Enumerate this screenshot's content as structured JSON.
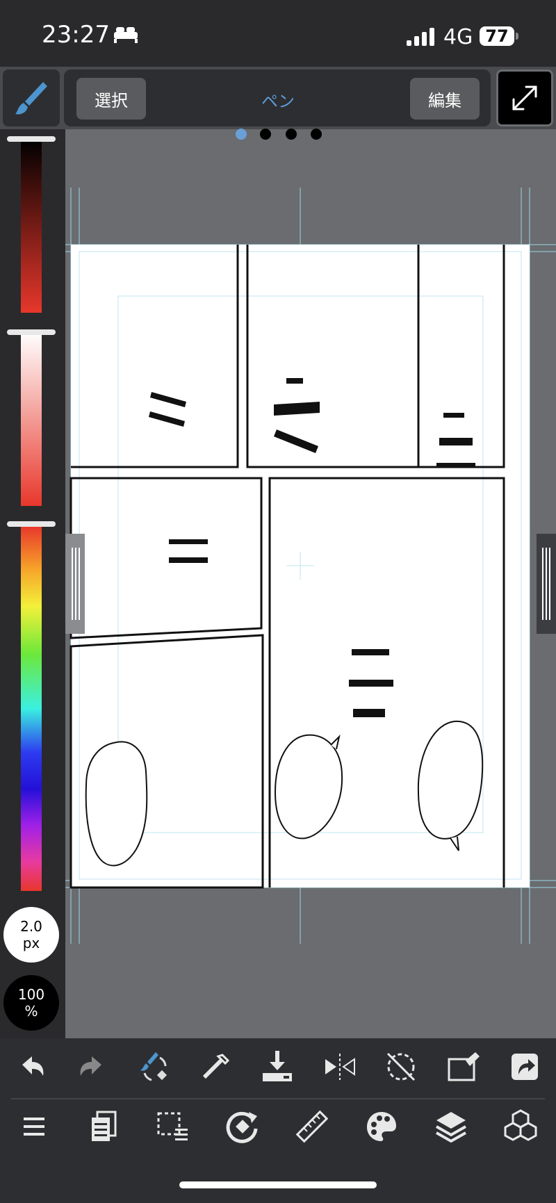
{
  "status_bar": {
    "time": "23:27",
    "network": "4G",
    "battery": "77",
    "icons": [
      "bed-icon",
      "signal-icon",
      "battery-icon"
    ]
  },
  "top_toolbar": {
    "select_label": "選択",
    "title": "ペン",
    "edit_label": "編集",
    "icons": [
      "brush-icon",
      "fullscreen-icon"
    ]
  },
  "pager": {
    "count": 4,
    "active_index": 0
  },
  "left_panel": {
    "brush_size_value": "2.0",
    "brush_size_unit": "px",
    "opacity_value": "100",
    "opacity_unit": "%"
  },
  "colors": {
    "accent": "#5b9bd6",
    "panel_bg": "#2a2a2c",
    "canvas_bg": "#6a6c70",
    "paper": "#ffffff",
    "guide": "#9fd6e6"
  },
  "bottom_toolbar": {
    "row1": [
      "undo-icon",
      "redo-icon",
      "brush-eraser-toggle-icon",
      "eyedropper-icon",
      "save-download-icon",
      "flip-horizontal-icon",
      "rotate-reset-icon",
      "transform-icon",
      "share-icon"
    ],
    "row2": [
      "menu-icon",
      "pages-icon",
      "selection-icon",
      "rotate-canvas-icon",
      "ruler-icon",
      "palette-icon",
      "layers-icon",
      "materials-icon"
    ]
  }
}
